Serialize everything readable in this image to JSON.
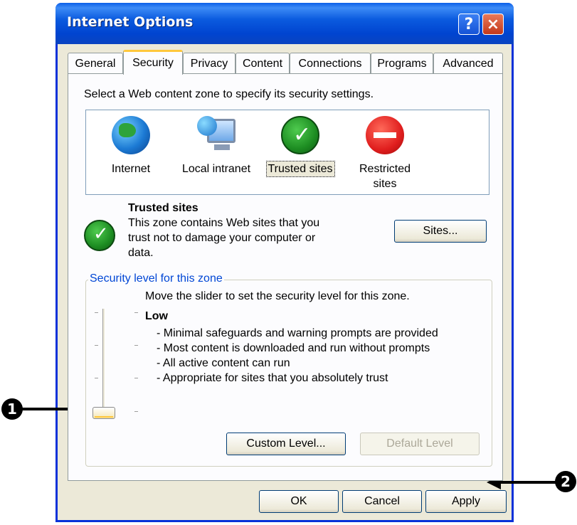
{
  "window": {
    "title": "Internet Options",
    "help_glyph": "?",
    "close_glyph": "×"
  },
  "tabs": [
    "General",
    "Security",
    "Privacy",
    "Content",
    "Connections",
    "Programs",
    "Advanced"
  ],
  "active_tab": "Security",
  "security": {
    "instruction": "Select a Web content zone to specify its security settings.",
    "zones": [
      {
        "name": "Internet",
        "icon": "globe-icon"
      },
      {
        "name": "Local intranet",
        "icon": "intranet-icon"
      },
      {
        "name": "Trusted sites",
        "icon": "checkmark-icon"
      },
      {
        "name": "Restricted sites",
        "icon": "no-entry-icon"
      }
    ],
    "selected_zone": "Trusted sites",
    "zone_heading": "Trusted sites",
    "zone_description": [
      "This zone contains Web sites that you",
      "trust not to damage your computer or",
      "data."
    ],
    "sites_button": "Sites...",
    "group_title": "Security level for this zone",
    "slider_hint": "Move the slider to set the security level for this zone.",
    "level_name": "Low",
    "level_details": [
      "- Minimal safeguards and warning prompts are provided",
      "- Most content is downloaded and run without prompts",
      "- All active content can run",
      "- Appropriate for sites that you absolutely trust"
    ],
    "custom_level_button": "Custom Level...",
    "default_level_button": "Default Level"
  },
  "footer": {
    "ok": "OK",
    "cancel": "Cancel",
    "apply": "Apply"
  },
  "callouts": {
    "one": "1",
    "two": "2"
  },
  "colors": {
    "title_bar": "#0054e3",
    "group_title": "#0046d5",
    "active_tab_accent": "#ffc83c"
  }
}
